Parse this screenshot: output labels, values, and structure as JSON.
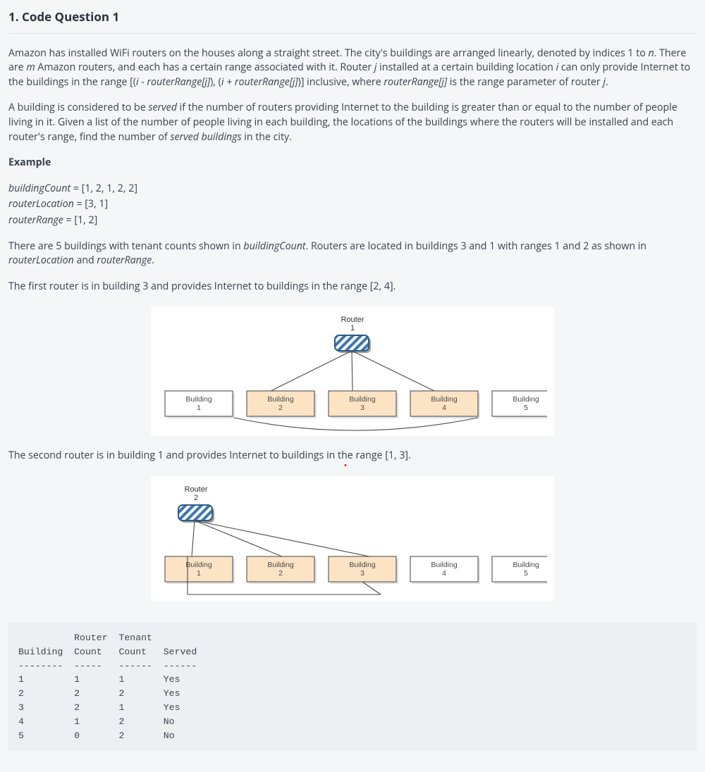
{
  "title": "1. Code Question 1",
  "paragraphs": {
    "intro1a": "Amazon has installed WiFi routers on the houses along a straight street. The city's buildings are arranged linearly, denoted by indices 1 to ",
    "n": "n",
    "intro1b": ". There are ",
    "m": "m",
    "intro1c": " Amazon routers, and each has a certain range associated with it. Router ",
    "j": "j",
    "intro1d": " installed at a certain building location ",
    "i": "i",
    "intro1e": " can only provide Internet to the buildings in the range [(",
    "irr1": "i - routerRange[j]",
    "intro1f": "), (",
    "irr2": "i + routerRange[j]",
    "intro1g": ")] inclusive, where ",
    "rrj": "routerRange[j]",
    "intro1h": " is the range parameter of router ",
    "j2": "j",
    "intro1i": ".",
    "intro2a": "A building is considered to be ",
    "served": "served",
    "intro2b": " if the number of routers providing Internet to the building is greater than or equal to the number of people living in it. Given a list of the number of people living in each building, the locations of the buildings where the routers will be installed and each router's range, find the number of ",
    "servedb": "served buildings",
    "intro2c": " in the city.",
    "example": "Example",
    "bc_name": "buildingCount",
    "bc_val": " = [1, 2, 1, 2, 2]",
    "rl_name": "routerLocation",
    "rl_val": " = [3, 1]",
    "rr_name": "routerRange",
    "rr_val": " = [1, 2]",
    "there1": "There are 5 buildings with tenant counts shown in ",
    "bc_i": "buildingCount",
    "there2": ".  Routers are located in buildings 3 and 1 with ranges 1 and 2 as shown in ",
    "rl_i": "routerLocation",
    "there3": " and ",
    "rr_i": "routerRange",
    "there_end": ".",
    "first": "The first router is in building 3 and provides Internet to buildings in the range [2, 4].",
    "second1": "The second router is in building 1 and provides Internet to buildings in ",
    "second_the": "the",
    "second2": " range [1, 3]."
  },
  "diagram1": {
    "router_label": "Router",
    "router_num": "1",
    "buildings": [
      {
        "label": "Building",
        "num": "1",
        "served": false
      },
      {
        "label": "Building",
        "num": "2",
        "served": true
      },
      {
        "label": "Building",
        "num": "3",
        "served": true
      },
      {
        "label": "Building",
        "num": "4",
        "served": true
      },
      {
        "label": "Building",
        "num": "5",
        "served": false
      }
    ]
  },
  "diagram2": {
    "router_label": "Router",
    "router_num": "2",
    "buildings": [
      {
        "label": "Building",
        "num": "1",
        "served": true
      },
      {
        "label": "Building",
        "num": "2",
        "served": true
      },
      {
        "label": "Building",
        "num": "3",
        "served": true
      },
      {
        "label": "Building",
        "num": "4",
        "served": false
      },
      {
        "label": "Building",
        "num": "5",
        "served": false
      }
    ]
  },
  "table": {
    "text": "          Router  Tenant\nBuilding  Count   Count   Served\n--------  -----   ------  ------\n1         1       1       Yes\n2         2       2       Yes\n3         2       1       Yes\n4         1       2       No\n5         0       2       No"
  }
}
